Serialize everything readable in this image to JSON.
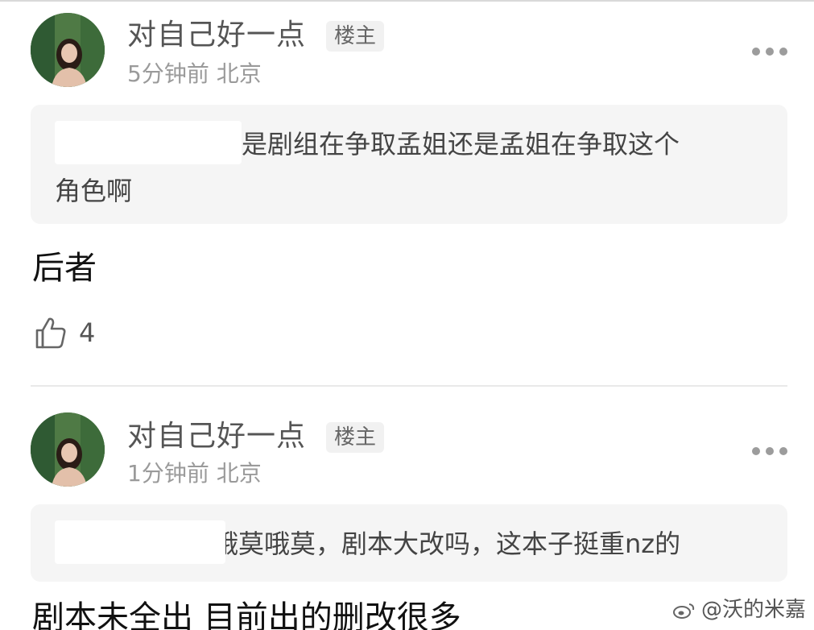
{
  "posts": [
    {
      "author": "对自己好一点",
      "badge": "楼主",
      "meta": "5分钟前 北京",
      "quote_line1": "反是剧组在争取孟姐还是孟姐在争取这个",
      "quote_line2": "角色啊",
      "reply": "后者",
      "likes": "4"
    },
    {
      "author": "对自己好一点",
      "badge": "楼主",
      "meta": "1分钟前 北京",
      "quote_line1": "哦莫哦莫，剧本大改吗，这本子挺重nz的",
      "reply": "剧本未全出 目前出的删改很多"
    }
  ],
  "watermark": "@沃的米嘉",
  "icons": {
    "more": "more-dots-icon",
    "like": "thumbs-up-icon",
    "avatar": "avatar-photo",
    "weibo": "weibo-logo-icon"
  }
}
